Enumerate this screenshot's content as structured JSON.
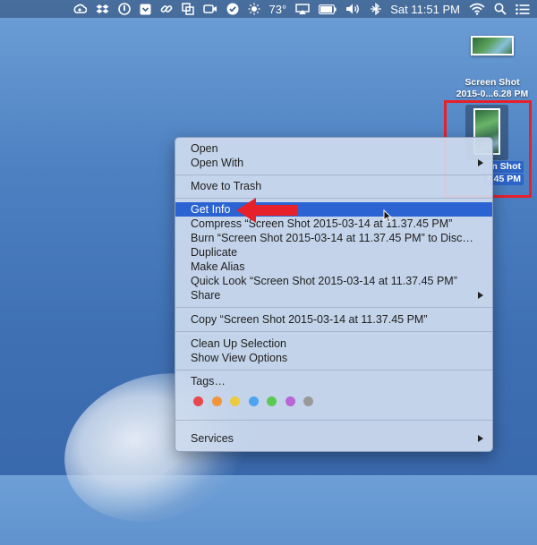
{
  "menubar": {
    "weather": "73°",
    "datetime": "Sat 11:51 PM"
  },
  "desktop": {
    "file1_label_line1": "Screen Shot",
    "file1_label_line2": "2015-0...6.28 PM",
    "file2_label_line1": "n Shot",
    "file2_label_line2": "7.45 PM"
  },
  "context_menu": {
    "open": "Open",
    "open_with": "Open With",
    "move_to_trash": "Move to Trash",
    "get_info": "Get Info",
    "compress": "Compress “Screen Shot 2015-03-14 at 11.37.45 PM”",
    "burn": "Burn “Screen Shot 2015-03-14 at 11.37.45 PM” to Disc…",
    "duplicate": "Duplicate",
    "make_alias": "Make Alias",
    "quick_look": "Quick Look “Screen Shot 2015-03-14 at 11.37.45 PM”",
    "share": "Share",
    "copy": "Copy “Screen Shot 2015-03-14 at 11.37.45 PM”",
    "clean_up_selection": "Clean Up Selection",
    "show_view_options": "Show View Options",
    "tags": "Tags…",
    "services": "Services"
  },
  "tag_colors": {
    "red": "#e8474b",
    "orange": "#f0953a",
    "yellow": "#eccb3e",
    "blue": "#4ea4ef",
    "green": "#5cc954",
    "purple": "#b866d6",
    "gray": "#999999"
  },
  "colors": {
    "highlight": "#2b63d2",
    "annotation_red": "#e8202a"
  }
}
